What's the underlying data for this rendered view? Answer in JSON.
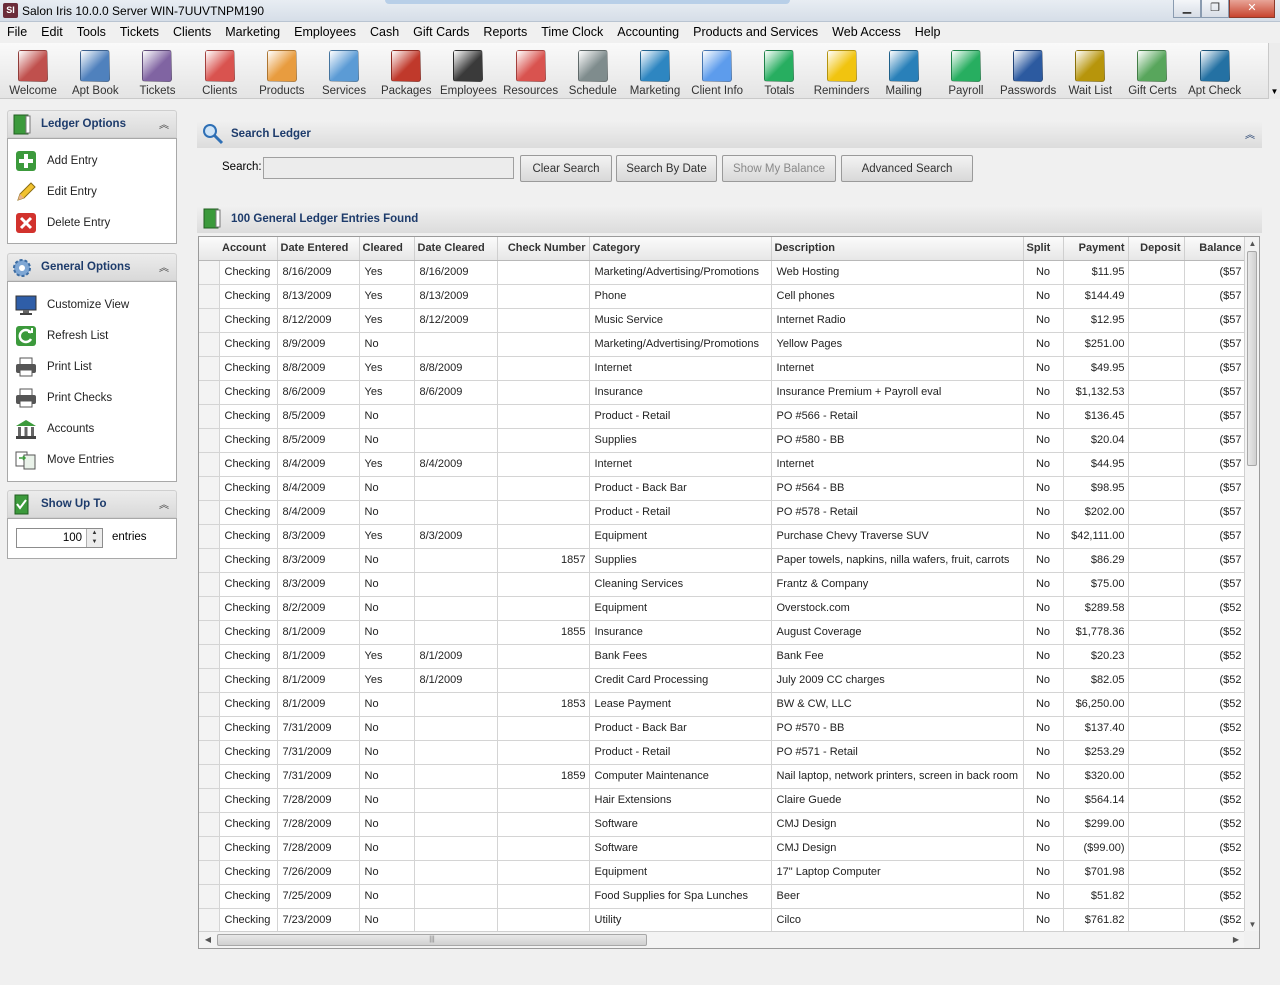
{
  "window": {
    "title": "Salon Iris 10.0.0 Server WIN-7UUVTNPM190",
    "app_icon_text": "SI"
  },
  "menu": [
    "File",
    "Edit",
    "Tools",
    "Tickets",
    "Clients",
    "Marketing",
    "Employees",
    "Cash",
    "Gift Cards",
    "Reports",
    "Time Clock",
    "Accounting",
    "Products and Services",
    "Web Access",
    "Help"
  ],
  "toolbar": [
    {
      "label": "Welcome",
      "icon": "house-icon",
      "color": "#c0504d"
    },
    {
      "label": "Apt Book",
      "icon": "calendar-icon",
      "color": "#4f81bd"
    },
    {
      "label": "Tickets",
      "icon": "tickets-icon",
      "color": "#8064a2"
    },
    {
      "label": "Clients",
      "icon": "clients-icon",
      "color": "#d9534f"
    },
    {
      "label": "Products",
      "icon": "shopping-bag-icon",
      "color": "#e89c3f"
    },
    {
      "label": "Services",
      "icon": "services-icon",
      "color": "#5b9bd5"
    },
    {
      "label": "Packages",
      "icon": "packages-icon",
      "color": "#c0392b"
    },
    {
      "label": "Employees",
      "icon": "employee-icon",
      "color": "#3a3a3a"
    },
    {
      "label": "Resources",
      "icon": "resources-icon",
      "color": "#d9534f"
    },
    {
      "label": "Schedule",
      "icon": "schedule-icon",
      "color": "#7f8c8d"
    },
    {
      "label": "Marketing",
      "icon": "marketing-icon",
      "color": "#2e86c1"
    },
    {
      "label": "Client Info",
      "icon": "client-info-icon",
      "color": "#5d9cec"
    },
    {
      "label": "Totals",
      "icon": "totals-chart-icon",
      "color": "#27ae60"
    },
    {
      "label": "Reminders",
      "icon": "bell-icon",
      "color": "#f1c40f"
    },
    {
      "label": "Mailing",
      "icon": "mailing-icon",
      "color": "#2980b9"
    },
    {
      "label": "Payroll",
      "icon": "money-icon",
      "color": "#27ae60"
    },
    {
      "label": "Passwords",
      "icon": "shield-icon",
      "color": "#2c5aa0"
    },
    {
      "label": "Wait List",
      "icon": "hourglass-icon",
      "color": "#b7950b"
    },
    {
      "label": "Gift Certs",
      "icon": "gift-cert-icon",
      "color": "#58a65c"
    },
    {
      "label": "Apt Check",
      "icon": "globe-icon",
      "color": "#2471a3"
    }
  ],
  "ledger_options": {
    "title": "Ledger Options",
    "items": [
      {
        "label": "Add Entry",
        "icon": "add-icon"
      },
      {
        "label": "Edit Entry",
        "icon": "pencil-icon"
      },
      {
        "label": "Delete Entry",
        "icon": "delete-icon"
      }
    ]
  },
  "general_options": {
    "title": "General Options",
    "items": [
      {
        "label": "Customize View",
        "icon": "monitor-icon"
      },
      {
        "label": "Refresh List",
        "icon": "refresh-icon"
      },
      {
        "label": "Print List",
        "icon": "printer-icon"
      },
      {
        "label": "Print Checks",
        "icon": "printer-icon"
      },
      {
        "label": "Accounts",
        "icon": "bank-icon"
      },
      {
        "label": "Move Entries",
        "icon": "move-icon"
      }
    ]
  },
  "show_up_to": {
    "title": "Show Up To",
    "value": "100",
    "suffix": "entries"
  },
  "search": {
    "header": "Search Ledger",
    "label": "Search:",
    "value": "",
    "buttons": {
      "clear": "Clear Search",
      "by_date": "Search By Date",
      "balance": "Show My Balance",
      "advanced": "Advanced Search"
    }
  },
  "results": {
    "header": "100 General Ledger Entries Found",
    "columns": [
      "Account",
      "Date Entered",
      "Cleared",
      "Date Cleared",
      "Check Number",
      "Category",
      "Description",
      "Split",
      "Payment",
      "Deposit",
      "Balance"
    ],
    "rows": [
      [
        "Checking",
        "8/16/2009",
        "Yes",
        "8/16/2009",
        "",
        "Marketing/Advertising/Promotions",
        "Web Hosting",
        "No",
        "$11.95",
        "",
        "($57"
      ],
      [
        "Checking",
        "8/13/2009",
        "Yes",
        "8/13/2009",
        "",
        "Phone",
        "Cell phones",
        "No",
        "$144.49",
        "",
        "($57"
      ],
      [
        "Checking",
        "8/12/2009",
        "Yes",
        "8/12/2009",
        "",
        "Music Service",
        "Internet Radio",
        "No",
        "$12.95",
        "",
        "($57"
      ],
      [
        "Checking",
        "8/9/2009",
        "No",
        "",
        "",
        "Marketing/Advertising/Promotions",
        "Yellow Pages",
        "No",
        "$251.00",
        "",
        "($57"
      ],
      [
        "Checking",
        "8/8/2009",
        "Yes",
        "8/8/2009",
        "",
        "Internet",
        "Internet",
        "No",
        "$49.95",
        "",
        "($57"
      ],
      [
        "Checking",
        "8/6/2009",
        "Yes",
        "8/6/2009",
        "",
        "Insurance",
        "Insurance Premium + Payroll eval",
        "No",
        "$1,132.53",
        "",
        "($57"
      ],
      [
        "Checking",
        "8/5/2009",
        "No",
        "",
        "",
        "Product - Retail",
        "PO #566 - Retail",
        "No",
        "$136.45",
        "",
        "($57"
      ],
      [
        "Checking",
        "8/5/2009",
        "No",
        "",
        "",
        "Supplies",
        "PO #580 - BB",
        "No",
        "$20.04",
        "",
        "($57"
      ],
      [
        "Checking",
        "8/4/2009",
        "Yes",
        "8/4/2009",
        "",
        "Internet",
        "Internet",
        "No",
        "$44.95",
        "",
        "($57"
      ],
      [
        "Checking",
        "8/4/2009",
        "No",
        "",
        "",
        "Product - Back Bar",
        "PO #564 - BB",
        "No",
        "$98.95",
        "",
        "($57"
      ],
      [
        "Checking",
        "8/4/2009",
        "No",
        "",
        "",
        "Product - Retail",
        "PO #578 - Retail",
        "No",
        "$202.00",
        "",
        "($57"
      ],
      [
        "Checking",
        "8/3/2009",
        "Yes",
        "8/3/2009",
        "",
        "Equipment",
        "Purchase Chevy Traverse SUV",
        "No",
        "$42,111.00",
        "",
        "($57"
      ],
      [
        "Checking",
        "8/3/2009",
        "No",
        "",
        "1857",
        "Supplies",
        "Paper towels, napkins, nilla wafers, fruit, carrots",
        "No",
        "$86.29",
        "",
        "($57"
      ],
      [
        "Checking",
        "8/3/2009",
        "No",
        "",
        "",
        "Cleaning Services",
        "Frantz & Company",
        "No",
        "$75.00",
        "",
        "($57"
      ],
      [
        "Checking",
        "8/2/2009",
        "No",
        "",
        "",
        "Equipment",
        "Overstock.com",
        "No",
        "$289.58",
        "",
        "($52"
      ],
      [
        "Checking",
        "8/1/2009",
        "No",
        "",
        "1855",
        "Insurance",
        "August Coverage",
        "No",
        "$1,778.36",
        "",
        "($52"
      ],
      [
        "Checking",
        "8/1/2009",
        "Yes",
        "8/1/2009",
        "",
        "Bank Fees",
        "Bank Fee",
        "No",
        "$20.23",
        "",
        "($52"
      ],
      [
        "Checking",
        "8/1/2009",
        "Yes",
        "8/1/2009",
        "",
        "Credit Card Processing",
        "July 2009 CC charges",
        "No",
        "$82.05",
        "",
        "($52"
      ],
      [
        "Checking",
        "8/1/2009",
        "No",
        "",
        "1853",
        "Lease Payment",
        "BW & CW, LLC",
        "No",
        "$6,250.00",
        "",
        "($52"
      ],
      [
        "Checking",
        "7/31/2009",
        "No",
        "",
        "",
        "Product - Back Bar",
        "PO #570 - BB",
        "No",
        "$137.40",
        "",
        "($52"
      ],
      [
        "Checking",
        "7/31/2009",
        "No",
        "",
        "",
        "Product - Retail",
        "PO #571 - Retail",
        "No",
        "$253.29",
        "",
        "($52"
      ],
      [
        "Checking",
        "7/31/2009",
        "No",
        "",
        "1859",
        "Computer Maintenance",
        "Nail laptop, network printers, screen in back room",
        "No",
        "$320.00",
        "",
        "($52"
      ],
      [
        "Checking",
        "7/28/2009",
        "No",
        "",
        "",
        "Hair Extensions",
        "Claire Guede",
        "No",
        "$564.14",
        "",
        "($52"
      ],
      [
        "Checking",
        "7/28/2009",
        "No",
        "",
        "",
        "Software",
        "CMJ Design",
        "No",
        "$299.00",
        "",
        "($52"
      ],
      [
        "Checking",
        "7/28/2009",
        "No",
        "",
        "",
        "Software",
        "CMJ Design",
        "No",
        "($99.00)",
        "",
        "($52"
      ],
      [
        "Checking",
        "7/26/2009",
        "No",
        "",
        "",
        "Equipment",
        "17\" Laptop Computer",
        "No",
        "$701.98",
        "",
        "($52"
      ],
      [
        "Checking",
        "7/25/2009",
        "No",
        "",
        "",
        "Food Supplies for Spa Lunches",
        "Beer",
        "No",
        "$51.82",
        "",
        "($52"
      ],
      [
        "Checking",
        "7/23/2009",
        "No",
        "",
        "",
        "Utility",
        "Cilco",
        "No",
        "$761.82",
        "",
        "($52"
      ]
    ]
  }
}
